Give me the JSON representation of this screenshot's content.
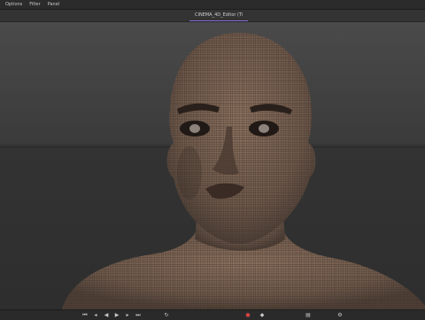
{
  "menu": {
    "items": [
      "Options",
      "Filter",
      "Panel"
    ]
  },
  "tab": {
    "title": "CINEMA_4D_Editor (Ti"
  },
  "viewport": {
    "subject": "wireframe-head-model",
    "colors": {
      "skin_wire": "#7f6756",
      "background_upper": "#4a4a4a",
      "background_lower": "#2e2e2e",
      "horizon": "#242424"
    }
  },
  "toolbar": {
    "icons": [
      "frame-start-icon",
      "frame-prev-icon",
      "play-reverse-icon",
      "play-icon",
      "frame-next-icon",
      "frame-end-icon",
      "loop-icon",
      "record-icon",
      "keyframe-icon",
      "timeline-icon",
      "settings-icon"
    ]
  }
}
